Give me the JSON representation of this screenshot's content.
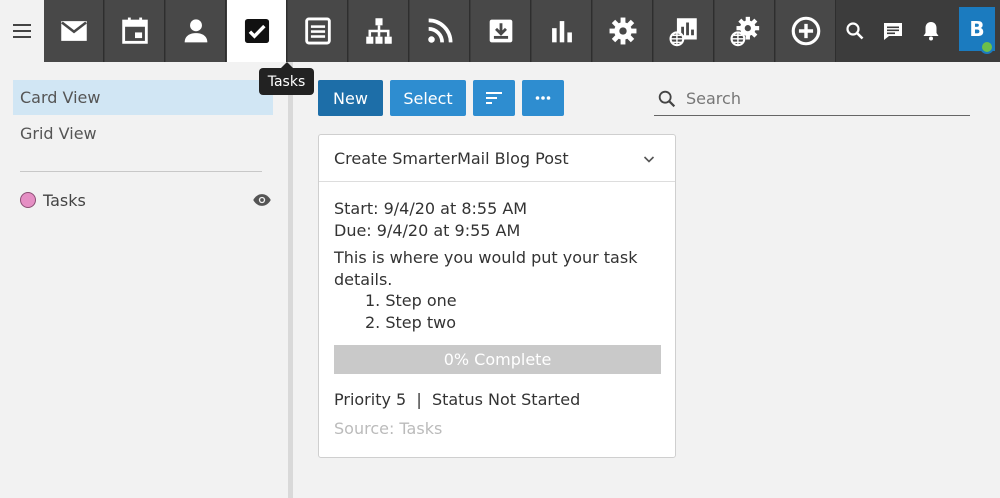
{
  "tooltip": {
    "text": "Tasks"
  },
  "sidebar": {
    "views": [
      {
        "label": "Card View",
        "active": true
      },
      {
        "label": "Grid View",
        "active": false
      }
    ],
    "sources": [
      {
        "label": "Tasks",
        "color": "#e58fc4"
      }
    ]
  },
  "toolbar": {
    "new_label": "New",
    "select_label": "Select",
    "sort_icon": "sort-icon",
    "more_icon": "more-horizontal-icon"
  },
  "search": {
    "placeholder": "Search",
    "value": ""
  },
  "card": {
    "title": "Create SmarterMail Blog Post",
    "start": "Start: 9/4/20 at 8:55 AM",
    "due": "Due: 9/4/20 at 9:55 AM",
    "details_line1": "This is where you would put your task",
    "details_line2": "details.",
    "steps": [
      "1. Step one",
      "2. Step two"
    ],
    "progress_label": "0% Complete",
    "progress_value": 0,
    "priority_status": "Priority 5  |  Status Not Started",
    "source": "Source: Tasks"
  },
  "user": {
    "avatar_letter": "B",
    "status_color": "#6cc04a"
  },
  "colors": {
    "accent": "#2e8dd0",
    "accent_dark": "#1d6ea8",
    "topbar": "#3c3c3c"
  },
  "app_tabs": [
    "mail-icon",
    "calendar-icon",
    "contacts-icon",
    "tasks-icon",
    "notes-icon",
    "sitemap-icon",
    "rss-icon",
    "download-icon",
    "reports-icon",
    "settings-icon",
    "domain-reports-icon",
    "domain-settings-icon",
    "add-icon"
  ]
}
